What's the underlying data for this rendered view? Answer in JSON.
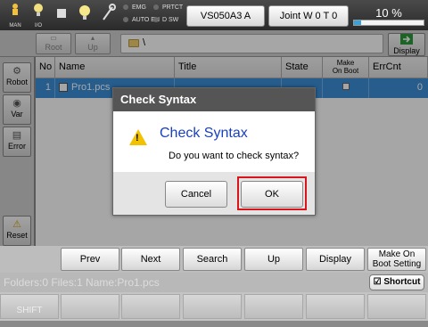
{
  "topbar": {
    "icons": [
      {
        "icon": "robot-man-icon",
        "label": "MAN"
      },
      {
        "icon": "bulb-io-icon",
        "label": "I/O"
      },
      {
        "icon": "stop-square-icon",
        "label": ""
      },
      {
        "icon": "lamp-icon",
        "label": ""
      },
      {
        "icon": "wrench-icon",
        "label": ""
      }
    ],
    "indicators": [
      "EMG",
      "PRTCT",
      "AUTO EN",
      "D SW"
    ],
    "robot_name": "VS050A3 A",
    "joint_mode": "Joint  W 0 T 0",
    "speed_text": "10 %",
    "speed_fraction": 0.1
  },
  "nav": {
    "root_label": "Root",
    "up_label": "Up",
    "path": "\\",
    "display_label": "Display"
  },
  "sidebar": {
    "robot": "Robot",
    "var": "Var",
    "error": "Error",
    "reset": "Reset"
  },
  "table": {
    "headers": [
      "No",
      "Name",
      "Title",
      "State",
      "Make On Boot",
      "ErrCnt"
    ],
    "make_on_boot_line1": "Make",
    "make_on_boot_line2": "On Boot",
    "rows": [
      {
        "no": "1",
        "name": "Pro1.pcs",
        "title": "",
        "state": "",
        "make_on_boot": true,
        "errcnt": "0"
      }
    ]
  },
  "dialog": {
    "title": "Check Syntax",
    "heading": "Check Syntax",
    "message": "Do you want to check syntax?",
    "cancel_label": "Cancel",
    "ok_label": "OK"
  },
  "functions": {
    "prev": "Prev",
    "next": "Next",
    "search": "Search",
    "up": "Up",
    "display": "Display",
    "make_on_boot_line1": "Make On",
    "make_on_boot_line2": "Boot Setting"
  },
  "status": {
    "text": "Folders:0  Files:1  Name:Pro1.pcs",
    "shortcut": "Shortcut"
  },
  "softkeys": {
    "shift": "SHIFT"
  },
  "colors": {
    "selection": "#3c8fd8",
    "highlight_frame": "#d8141c",
    "heading": "#1a3fc0",
    "warning": "#f2c200"
  }
}
